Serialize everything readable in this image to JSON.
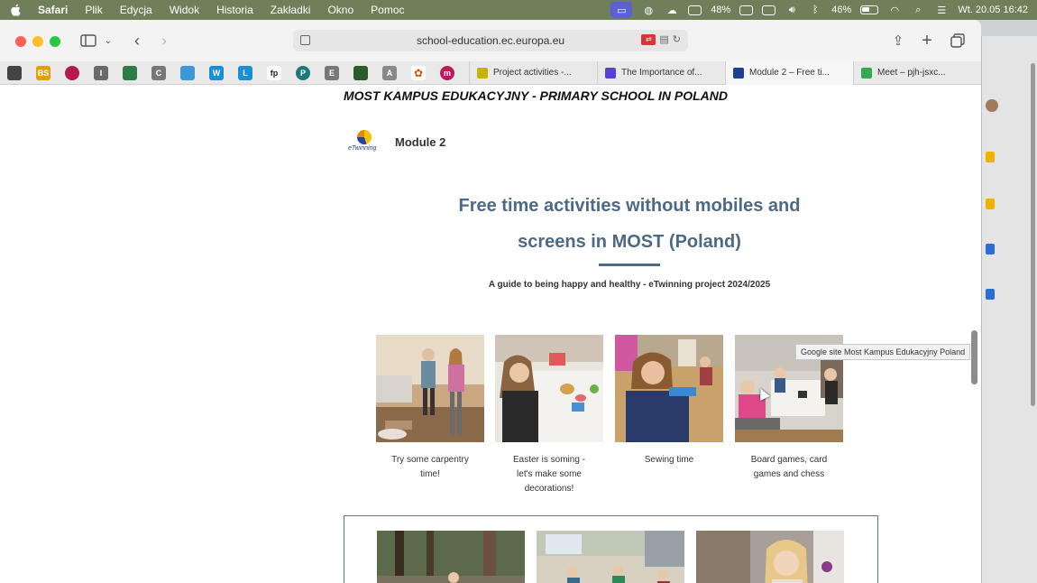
{
  "menubar": {
    "app": "Safari",
    "items": [
      "Plik",
      "Edycja",
      "Widok",
      "Historia",
      "Zakładki",
      "Okno",
      "Pomoc"
    ],
    "status": {
      "cpu": "48%",
      "battery": "46%",
      "datetime": "Wt. 20.05  16:42"
    }
  },
  "browser": {
    "url": "school-education.ec.europa.eu",
    "favorites": [
      {
        "icon": "qr-icon",
        "color": "#444444",
        "label": ""
      },
      {
        "icon": "bs-icon",
        "color": "#e0a100",
        "label": "BS"
      },
      {
        "icon": "star-icon",
        "color": "#b5174f",
        "label": ""
      },
      {
        "icon": "i-icon",
        "color": "#6a6a6a",
        "label": "I"
      },
      {
        "icon": "apps-icon",
        "color": "#2d7d46",
        "label": ""
      },
      {
        "icon": "c-icon",
        "color": "#777777",
        "label": "C"
      },
      {
        "icon": "grid-icon",
        "color": "#3a9ad9",
        "label": ""
      },
      {
        "icon": "w-icon",
        "color": "#1a8fd8",
        "label": "W"
      },
      {
        "icon": "l-icon",
        "color": "#1a8fd8",
        "label": "L"
      },
      {
        "icon": "fp-icon",
        "color": "#222222",
        "label": "fp"
      },
      {
        "icon": "p-icon",
        "color": "#1a7a7a",
        "label": "P"
      },
      {
        "icon": "e-icon",
        "color": "#777777",
        "label": "E"
      },
      {
        "icon": "qr2-icon",
        "color": "#2d5a2d",
        "label": ""
      },
      {
        "icon": "a-icon",
        "color": "#888888",
        "label": "A"
      },
      {
        "icon": "flower-icon",
        "color": "#d35400",
        "label": ""
      },
      {
        "icon": "m-icon",
        "color": "#c2185b",
        "label": "m"
      }
    ],
    "tabs": [
      {
        "label": "Project activities -...",
        "color": "#c8b400",
        "active": false
      },
      {
        "label": "The Importance of...",
        "color": "#5b3fd6",
        "active": false
      },
      {
        "label": "Module 2 – Free ti...",
        "color": "#1f3f8f",
        "active": true
      },
      {
        "label": "Meet – pjh-jsxc...",
        "color": "#34a853",
        "active": false
      }
    ]
  },
  "page": {
    "school_header": "MOST KAMPUS EDUKACYJNY - PRIMARY SCHOOL IN POLAND",
    "logo_text": "eTwinning",
    "module_title": "Module 2",
    "hero_line1": "Free time activities without mobiles and",
    "hero_line2": "screens in MOST (Poland)",
    "hero_subtitle": "A guide to being happy and healthy - eTwinning project 2024/2025",
    "tooltip": "Google site Most Kampus Edukacyjny Poland",
    "cards": [
      {
        "caption_line1": "Try some carpentry",
        "caption_line2": "time!",
        "caption_line3": ""
      },
      {
        "caption_line1": "Easter is soming -",
        "caption_line2": "let's make some",
        "caption_line3": "decorations!"
      },
      {
        "caption_line1": "Sewing time",
        "caption_line2": "",
        "caption_line3": ""
      },
      {
        "caption_line1": "Board games, card",
        "caption_line2": "games and chess",
        "caption_line3": ""
      }
    ]
  }
}
